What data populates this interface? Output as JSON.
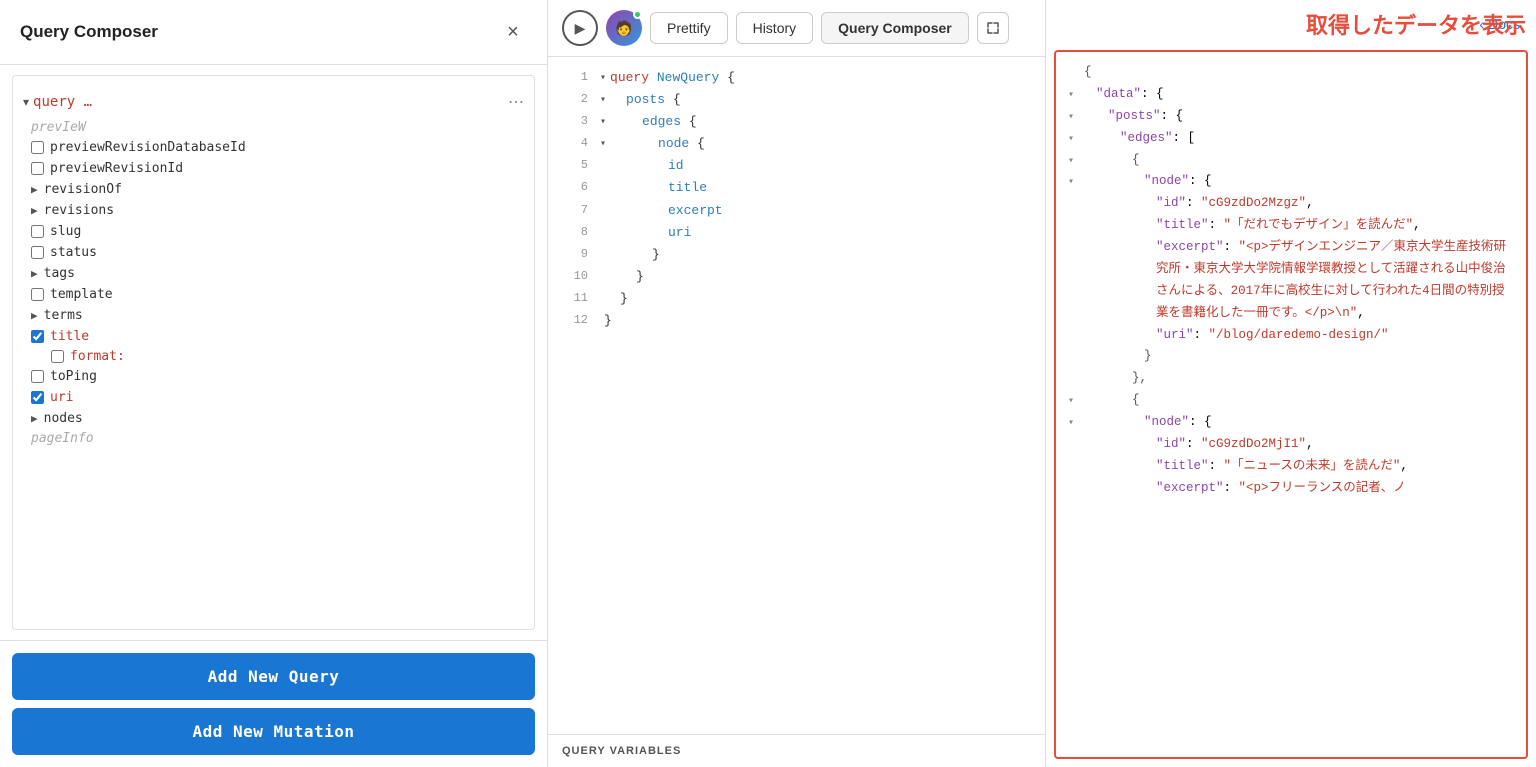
{
  "leftPanel": {
    "title": "Query Composer",
    "closeLabel": "×",
    "queryLabel": "query …",
    "treeItems": [
      {
        "type": "faded",
        "label": "prevIeW"
      },
      {
        "type": "unchecked",
        "label": "previewRevisionDatabaseId"
      },
      {
        "type": "unchecked",
        "label": "previewRevisionId"
      },
      {
        "type": "expandable",
        "label": "revisionOf"
      },
      {
        "type": "expandable",
        "label": "revisions"
      },
      {
        "type": "unchecked",
        "label": "slug"
      },
      {
        "type": "unchecked",
        "label": "status"
      },
      {
        "type": "expandable",
        "label": "tags"
      },
      {
        "type": "unchecked",
        "label": "template"
      },
      {
        "type": "expandable",
        "label": "terms"
      },
      {
        "type": "checked",
        "label": "title"
      },
      {
        "type": "sub-unchecked",
        "label": "format:"
      },
      {
        "type": "unchecked",
        "label": "toPing"
      },
      {
        "type": "checked",
        "label": "uri"
      },
      {
        "type": "expandable",
        "label": "nodes"
      },
      {
        "type": "faded",
        "label": "pageInfo"
      }
    ],
    "addQueryLabel": "Add New Query",
    "addMutationLabel": "Add New Mutation"
  },
  "toolbar": {
    "prettifyLabel": "Prettify",
    "historyLabel": "History",
    "queryComposerLabel": "Query Composer",
    "docsLabel": "Docs"
  },
  "codeEditor": {
    "lines": [
      {
        "num": 1,
        "arrow": true,
        "indent": 0,
        "tokens": [
          {
            "type": "kw",
            "text": "query"
          },
          {
            "type": "text",
            "text": " "
          },
          {
            "type": "fn",
            "text": "NewQuery"
          },
          {
            "type": "text",
            "text": " {"
          }
        ]
      },
      {
        "num": 2,
        "arrow": true,
        "indent": 1,
        "tokens": [
          {
            "type": "fn",
            "text": "posts"
          },
          {
            "type": "text",
            "text": " {"
          }
        ]
      },
      {
        "num": 3,
        "arrow": true,
        "indent": 2,
        "tokens": [
          {
            "type": "fn",
            "text": "edges"
          },
          {
            "type": "text",
            "text": " {"
          }
        ]
      },
      {
        "num": 4,
        "arrow": true,
        "indent": 3,
        "tokens": [
          {
            "type": "fn",
            "text": "node"
          },
          {
            "type": "text",
            "text": " {"
          }
        ]
      },
      {
        "num": 5,
        "arrow": false,
        "indent": 4,
        "tokens": [
          {
            "type": "fn",
            "text": "id"
          }
        ]
      },
      {
        "num": 6,
        "arrow": false,
        "indent": 4,
        "tokens": [
          {
            "type": "fn",
            "text": "title"
          }
        ]
      },
      {
        "num": 7,
        "arrow": false,
        "indent": 4,
        "tokens": [
          {
            "type": "fn",
            "text": "excerpt"
          }
        ]
      },
      {
        "num": 8,
        "arrow": false,
        "indent": 4,
        "tokens": [
          {
            "type": "fn",
            "text": "uri"
          }
        ]
      },
      {
        "num": 9,
        "arrow": false,
        "indent": 3,
        "tokens": [
          {
            "type": "text",
            "text": "}"
          }
        ]
      },
      {
        "num": 10,
        "arrow": false,
        "indent": 2,
        "tokens": [
          {
            "type": "text",
            "text": "}"
          }
        ]
      },
      {
        "num": 11,
        "arrow": false,
        "indent": 1,
        "tokens": [
          {
            "type": "text",
            "text": "}"
          }
        ]
      },
      {
        "num": 12,
        "arrow": false,
        "indent": 0,
        "tokens": [
          {
            "type": "text",
            "text": "}"
          }
        ]
      }
    ],
    "queryVariablesLabel": "QUERY VARIABLES"
  },
  "annotation": {
    "text": "取得したデータを表示"
  },
  "dataOutput": {
    "lines": [
      {
        "indent": 0,
        "arrow": false,
        "content": "{"
      },
      {
        "indent": 1,
        "arrow": true,
        "content": "\"data\": {"
      },
      {
        "indent": 2,
        "arrow": true,
        "content": "\"posts\": {"
      },
      {
        "indent": 3,
        "arrow": true,
        "content": "\"edges\": ["
      },
      {
        "indent": 4,
        "arrow": true,
        "content": "{"
      },
      {
        "indent": 5,
        "arrow": true,
        "content": "\"node\": {"
      },
      {
        "indent": 6,
        "arrow": false,
        "content": "\"id\": \"cG9zdDo2Mzgz\","
      },
      {
        "indent": 6,
        "arrow": false,
        "content": "\"title\": \"「だれでもデザイン」を読んだ\","
      },
      {
        "indent": 6,
        "arrow": false,
        "content": "\"excerpt\": \"<p>デザインエンジニア／東京大学生産技術研究所・東京大学大学院情報学環教授として活躍される山中俊治さんによる、2017年に高校生に対して行われた4日間の特別授業を書籍化した一冊です。</p>\\n\","
      },
      {
        "indent": 6,
        "arrow": false,
        "content": "\"uri\": \"/blog/daredemo-design/\""
      },
      {
        "indent": 5,
        "arrow": false,
        "content": "}"
      },
      {
        "indent": 4,
        "arrow": false,
        "content": "},"
      },
      {
        "indent": 4,
        "arrow": true,
        "content": "{"
      },
      {
        "indent": 5,
        "arrow": true,
        "content": "\"node\": {"
      },
      {
        "indent": 6,
        "arrow": false,
        "content": "\"id\": \"cG9zdDo2MjI1\","
      },
      {
        "indent": 6,
        "arrow": false,
        "content": "\"title\": \"「ニュースの未来」を読んだ\","
      },
      {
        "indent": 6,
        "arrow": false,
        "content": "\"excerpt\": \"<p>フリーランスの記者、ノ"
      }
    ]
  }
}
